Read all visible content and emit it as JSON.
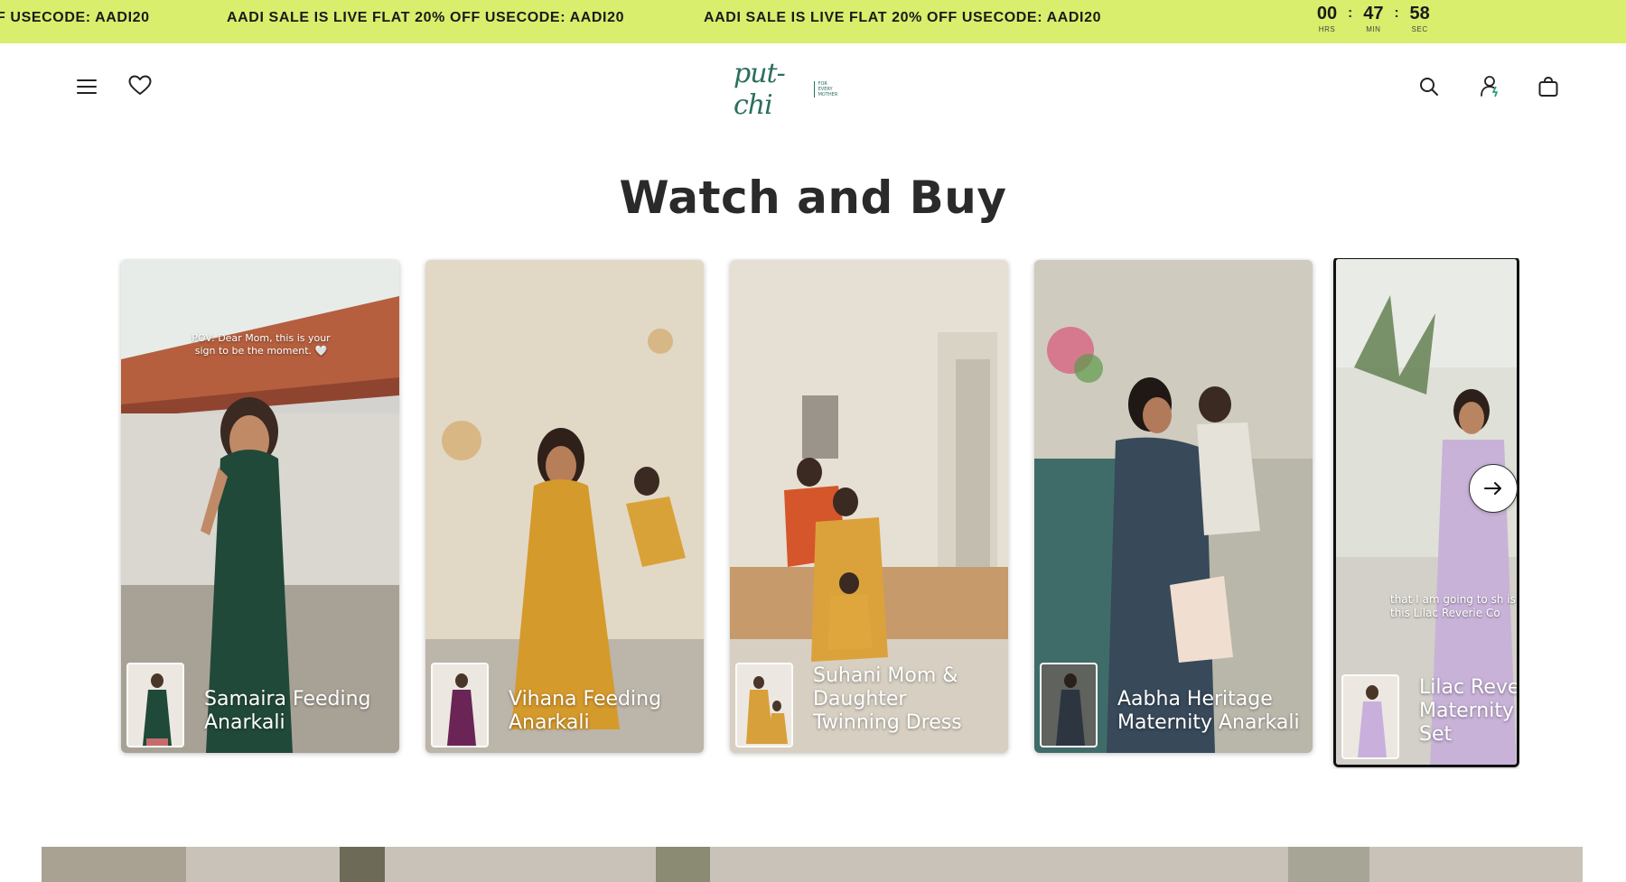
{
  "announcement": {
    "messages": [
      "F USECODE: AADI20",
      "AADI SALE IS LIVE FLAT 20% OFF USECODE: AADI20",
      "AADI SALE IS LIVE FLAT 20% OFF USECODE: AADI20"
    ],
    "timer": {
      "hours": "00",
      "minutes": "47",
      "seconds": "58",
      "hours_label": "HRS",
      "minutes_label": "MIN",
      "seconds_label": "SEC"
    }
  },
  "header": {
    "logo_script": "put-chi",
    "logo_tagline": "FOR EVERY MOTHER",
    "icons": [
      "menu-icon",
      "heart-icon",
      "search-icon",
      "account-icon",
      "bag-icon"
    ],
    "brand_color": "#2b6f5e"
  },
  "section": {
    "title": "Watch and Buy",
    "cards": [
      {
        "title": "Samaira Feeding Anarkali",
        "overlay": "POV: Dear Mom, this is your sign to be the moment. 🤍"
      },
      {
        "title": "Vihana Feeding Anarkali"
      },
      {
        "title": "Suhani Mom & Daughter Twinning Dress"
      },
      {
        "title": "Aabha Heritage Maternity Anarkali"
      },
      {
        "title": "Lilac Reve Maternity Set",
        "overlay": "that I am going to sh is this Lilac Reverie Co"
      }
    ],
    "next_icon": "arrow-right-icon"
  },
  "colors": {
    "announcement_bg": "#d8ee6c",
    "text_dark": "#2a2a2a"
  }
}
